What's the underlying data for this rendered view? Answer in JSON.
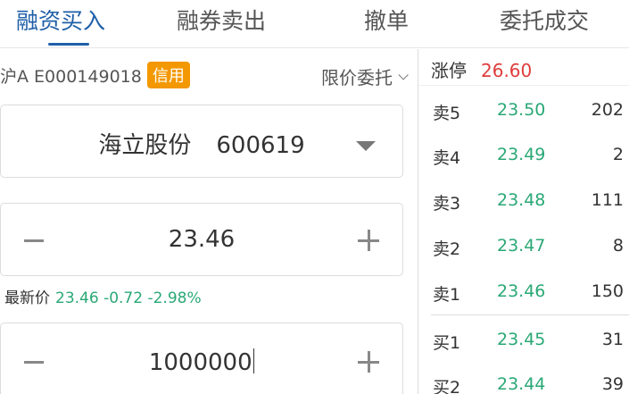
{
  "tabs": [
    {
      "label": "融资买入",
      "active": true
    },
    {
      "label": "融券卖出",
      "active": false
    },
    {
      "label": "撤单",
      "active": false
    },
    {
      "label": "委托成交",
      "active": false
    }
  ],
  "account": {
    "text": "沪A E000149018",
    "badge": "信用",
    "badge_color": "#f39800"
  },
  "order_type": {
    "label": "限价委托"
  },
  "stock": {
    "name": "海立股份",
    "code": "600619"
  },
  "price": {
    "value": "23.46"
  },
  "latest": {
    "label": "最新价",
    "values": "23.46 -0.72 -2.98%"
  },
  "quantity": {
    "value": "1000000"
  },
  "limit_up": {
    "label": "涨停",
    "value": "26.60"
  },
  "order_book": {
    "asks": [
      {
        "label": "卖5",
        "price": "23.50",
        "volume": "202"
      },
      {
        "label": "卖4",
        "price": "23.49",
        "volume": "2"
      },
      {
        "label": "卖3",
        "price": "23.48",
        "volume": "111"
      },
      {
        "label": "卖2",
        "price": "23.47",
        "volume": "8"
      },
      {
        "label": "卖1",
        "price": "23.46",
        "volume": "150"
      }
    ],
    "bids": [
      {
        "label": "买1",
        "price": "23.45",
        "volume": "31"
      },
      {
        "label": "买2",
        "price": "23.44",
        "volume": "39"
      }
    ]
  },
  "colors": {
    "accent": "#1f5fa8",
    "down": "#2aa876",
    "up": "#e03c3c"
  }
}
